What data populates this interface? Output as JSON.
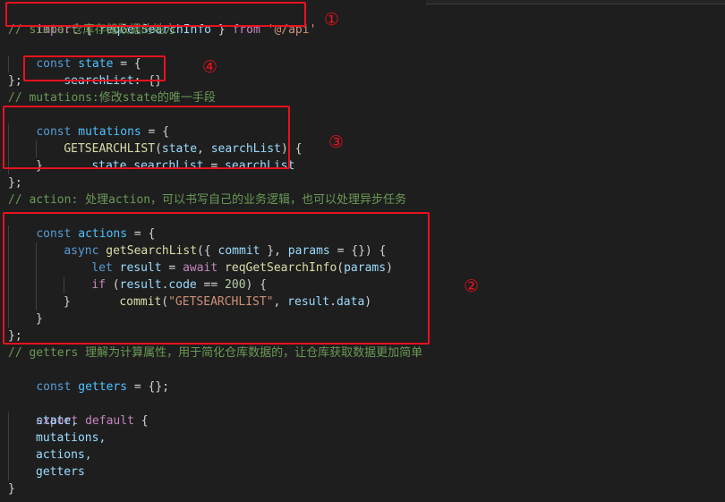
{
  "annotations": [
    "①",
    "②",
    "③",
    "④"
  ],
  "code": {
    "l1": {
      "import": "import",
      "open": " { ",
      "fn": "reqGetSearchInfo",
      "close": " } ",
      "from": "from",
      "path": "'@/api'"
    },
    "l2": "// state:仓库存储数据的地方",
    "l3": {
      "const": "const",
      "name": "state",
      "rest": " = {"
    },
    "l4": {
      "prop": "searchList",
      "rest": ": {}"
    },
    "l5": "};",
    "l6": "// mutations:修改state的唯一手段",
    "l7": {
      "const": "const",
      "name": "mutations",
      "rest": " = {"
    },
    "l8": {
      "fn": "GETSEARCHLIST",
      "p1": "state",
      "p2": "searchList"
    },
    "l9": {
      "obj": "state",
      "prop": "searchList",
      "rhs": "searchList"
    },
    "l10": "}",
    "l11": "};",
    "l12": "// action: 处理action，可以书写自己的业务逻辑，也可以处理异步任务",
    "l13": {
      "const": "const",
      "name": "actions",
      "rest": " = {"
    },
    "l14": {
      "async": "async",
      "fn": "getSearchList",
      "commit": "commit",
      "params": "params"
    },
    "l15": {
      "let": "let",
      "var": "result",
      "await": "await",
      "fn": "reqGetSearchInfo",
      "arg": "params"
    },
    "l16": {
      "if": "if",
      "obj": "result",
      "prop": "code",
      "num": "200"
    },
    "l17": {
      "fn": "commit",
      "str": "\"GETSEARCHLIST\"",
      "obj": "result",
      "prop": "data"
    },
    "l18": "}",
    "l19": "}",
    "l20": "};",
    "l21": "// getters 理解为计算属性，用于简化仓库数据的，让仓库获取数据更加简单",
    "l22": {
      "const": "const",
      "name": "getters",
      "rest": " = {};"
    },
    "l24": {
      "export": "export",
      "default": "default",
      "rest": " {"
    },
    "l25": "state,",
    "l26": "mutations,",
    "l27": "actions,",
    "l28": "getters",
    "l29": "}"
  }
}
